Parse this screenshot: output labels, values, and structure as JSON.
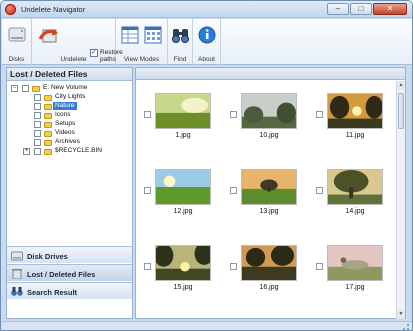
{
  "window": {
    "title": "Undelete Navigator",
    "controls": {
      "minimize": "–",
      "maximize": "□",
      "close": "✕"
    }
  },
  "ribbon": {
    "groups": [
      {
        "label": "Disks"
      },
      {
        "label": "Undelete"
      },
      {
        "label": "View Modes"
      },
      {
        "label": "Find"
      },
      {
        "label": "About"
      }
    ],
    "restore_paths": {
      "label": "Restore paths",
      "checked": true,
      "mark": "✓"
    }
  },
  "left_pane": {
    "header": "Lost / Deleted Files",
    "tree": {
      "root": {
        "label": "E: New Volume",
        "expander": "−"
      },
      "children": [
        {
          "label": "City Lights",
          "selected": false
        },
        {
          "label": "Nature",
          "selected": true
        },
        {
          "label": "Icons",
          "selected": false
        },
        {
          "label": "Setups",
          "selected": false
        },
        {
          "label": "Videos",
          "selected": false
        },
        {
          "label": "Archives",
          "selected": false
        },
        {
          "label": "$RECYCLE.BIN",
          "selected": false,
          "expander": "+"
        }
      ]
    },
    "nav_buttons": [
      {
        "label": "Disk Drives",
        "icon": "disk-icon",
        "active": false
      },
      {
        "label": "Lost / Deleted Files",
        "icon": "trash-icon",
        "active": true
      },
      {
        "label": "Search Result",
        "icon": "binoculars-icon",
        "active": false
      }
    ]
  },
  "files": [
    {
      "name": "1.jpg",
      "icon": "grass-photo"
    },
    {
      "name": "10.jpg",
      "icon": "misty-trees-photo"
    },
    {
      "name": "11.jpg",
      "icon": "sunset-trees-photo"
    },
    {
      "name": "12.jpg",
      "icon": "meadow-photo"
    },
    {
      "name": "13.jpg",
      "icon": "lone-tree-photo"
    },
    {
      "name": "14.jpg",
      "icon": "big-tree-photo"
    },
    {
      "name": "15.jpg",
      "icon": "forest-sun-photo"
    },
    {
      "name": "16.jpg",
      "icon": "dusk-forest-photo"
    },
    {
      "name": "17.jpg",
      "icon": "pink-field-photo"
    }
  ],
  "scroll": {
    "up": "▲",
    "down": "▼"
  },
  "colors": {
    "selection": "#3a7bd5",
    "titlebar": "#c3d6ec",
    "folder": "#f2cc53",
    "accent": "#2b6cc4"
  }
}
